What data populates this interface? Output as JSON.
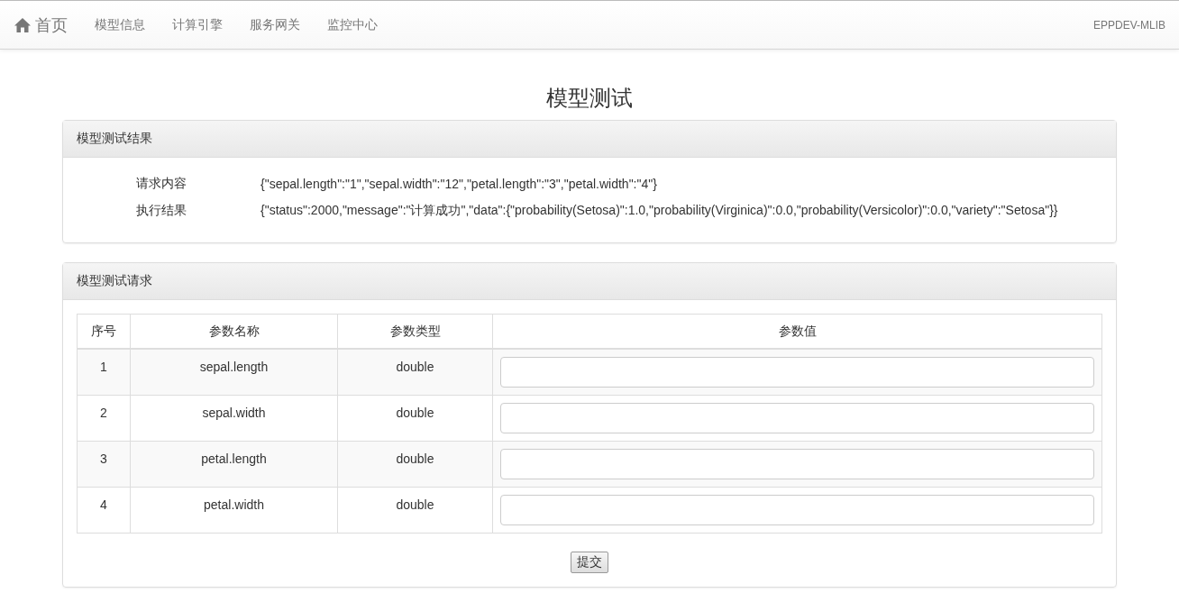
{
  "navbar": {
    "brand": "首页",
    "links": [
      {
        "label": "模型信息"
      },
      {
        "label": "计算引擎"
      },
      {
        "label": "服务网关"
      },
      {
        "label": "监控中心"
      }
    ],
    "user": "EPPDEV-MLIB"
  },
  "page_title": "模型测试",
  "result_panel": {
    "title": "模型测试结果",
    "rows": [
      {
        "label": "请求内容",
        "value": "{\"sepal.length\":\"1\",\"sepal.width\":\"12\",\"petal.length\":\"3\",\"petal.width\":\"4\"}"
      },
      {
        "label": "执行结果",
        "value": "{\"status\":2000,\"message\":\"计算成功\",\"data\":{\"probability(Setosa)\":1.0,\"probability(Virginica)\":0.0,\"probability(Versicolor)\":0.0,\"variety\":\"Setosa\"}}"
      }
    ]
  },
  "request_panel": {
    "title": "模型测试请求",
    "table": {
      "columns": [
        "序号",
        "参数名称",
        "参数类型",
        "参数值"
      ],
      "rows": [
        {
          "index": "1",
          "name": "sepal.length",
          "type": "double"
        },
        {
          "index": "2",
          "name": "sepal.width",
          "type": "double"
        },
        {
          "index": "3",
          "name": "petal.length",
          "type": "double"
        },
        {
          "index": "4",
          "name": "petal.width",
          "type": "double"
        }
      ]
    },
    "submit_button": "提交"
  }
}
